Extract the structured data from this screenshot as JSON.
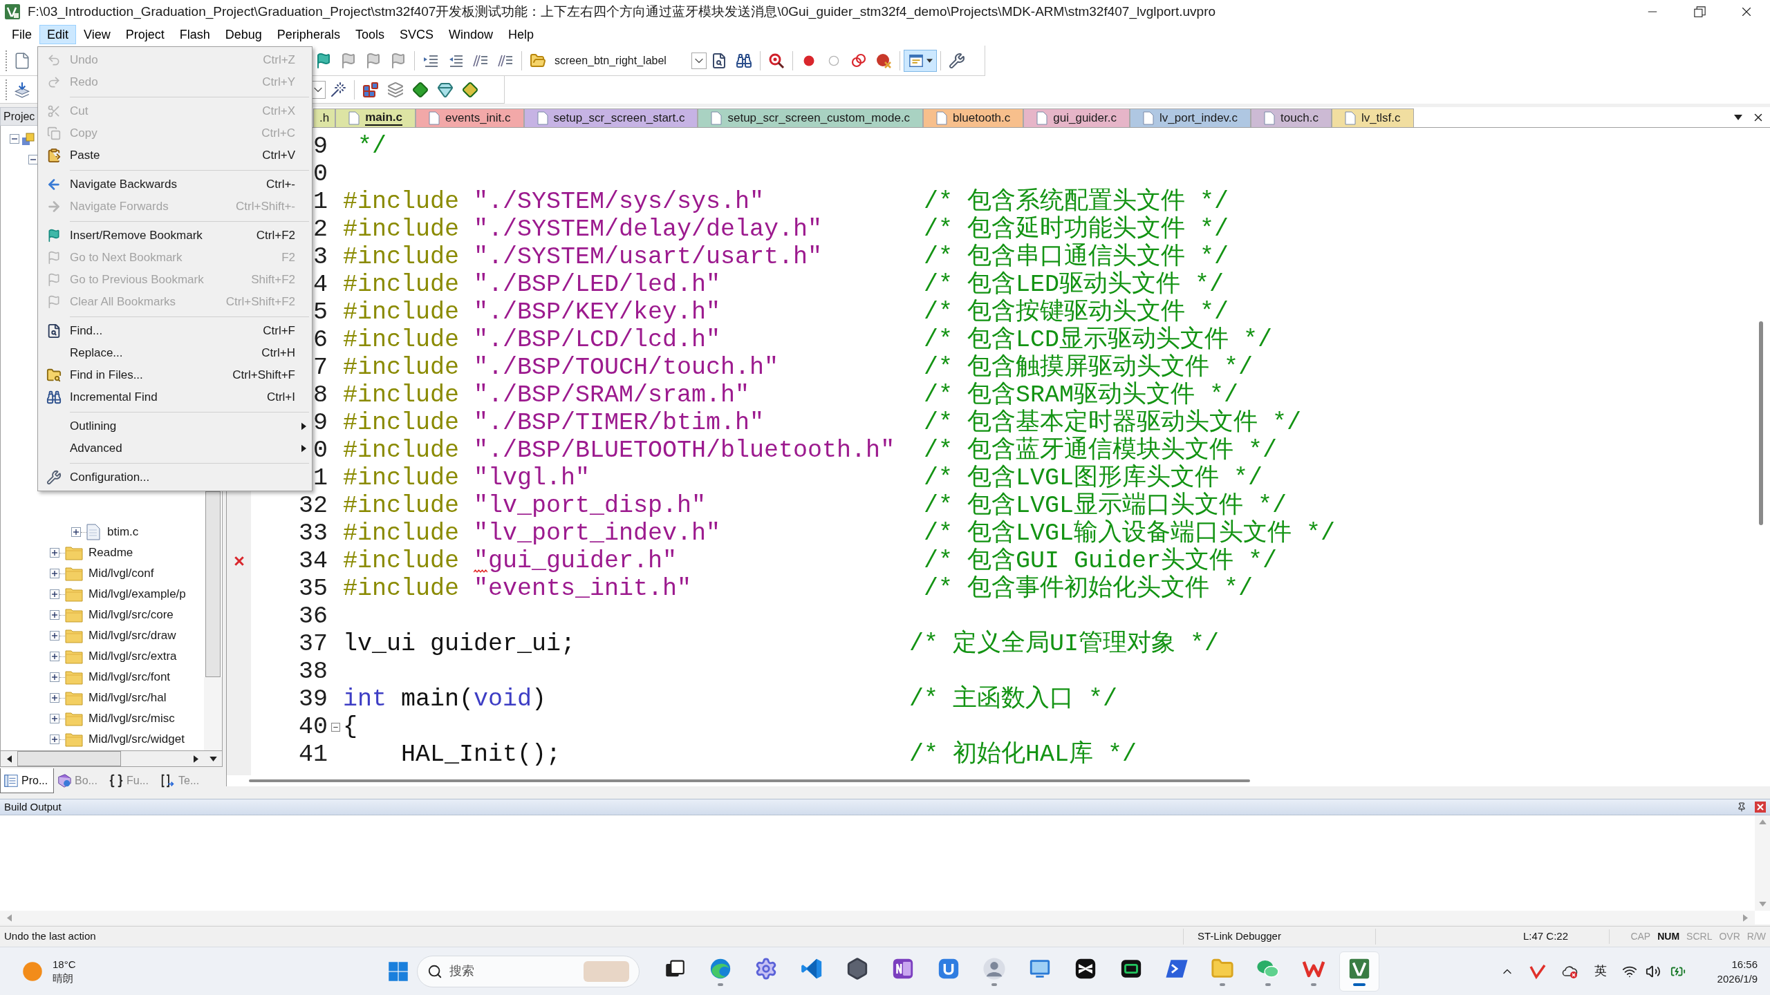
{
  "window": {
    "title": "F:\\03_Introduction_Graduation_Project\\Graduation_Project\\stm32f407开发板测试功能：上下左右四个方向通过蓝牙模块发送消息\\0Gui_guider_stm32f4_demo\\Projects\\MDK-ARM\\stm32f407_lvglport.uvpro"
  },
  "menu_bar": [
    {
      "label": "File",
      "selected": false
    },
    {
      "label": "Edit",
      "selected": true
    },
    {
      "label": "View",
      "selected": false
    },
    {
      "label": "Project",
      "selected": false
    },
    {
      "label": "Flash",
      "selected": false
    },
    {
      "label": "Debug",
      "selected": false
    },
    {
      "label": "Peripherals",
      "selected": false
    },
    {
      "label": "Tools",
      "selected": false
    },
    {
      "label": "SVCS",
      "selected": false
    },
    {
      "label": "Window",
      "selected": false
    },
    {
      "label": "Help",
      "selected": false
    }
  ],
  "toolbar": {
    "target_field": "screen_btn_right_label",
    "layout_button_pressed": true
  },
  "edit_menu": {
    "groups": [
      [
        {
          "label": "Undo",
          "shortcut": "Ctrl+Z",
          "disabled": true,
          "submenu": false
        },
        {
          "label": "Redo",
          "shortcut": "Ctrl+Y",
          "disabled": true,
          "submenu": false
        }
      ],
      [
        {
          "label": "Cut",
          "shortcut": "Ctrl+X",
          "disabled": true,
          "submenu": false
        },
        {
          "label": "Copy",
          "shortcut": "Ctrl+C",
          "disabled": true,
          "submenu": false
        },
        {
          "label": "Paste",
          "shortcut": "Ctrl+V",
          "disabled": false,
          "submenu": false
        }
      ],
      [
        {
          "label": "Navigate Backwards",
          "shortcut": "Ctrl+-",
          "disabled": false,
          "submenu": false
        },
        {
          "label": "Navigate Forwards",
          "shortcut": "Ctrl+Shift+-",
          "disabled": true,
          "submenu": false
        }
      ],
      [
        {
          "label": "Insert/Remove Bookmark",
          "shortcut": "Ctrl+F2",
          "disabled": false,
          "submenu": false
        },
        {
          "label": "Go to Next Bookmark",
          "shortcut": "F2",
          "disabled": true,
          "submenu": false
        },
        {
          "label": "Go to Previous Bookmark",
          "shortcut": "Shift+F2",
          "disabled": true,
          "submenu": false
        },
        {
          "label": "Clear All Bookmarks",
          "shortcut": "Ctrl+Shift+F2",
          "disabled": true,
          "submenu": false
        }
      ],
      [
        {
          "label": "Find...",
          "shortcut": "Ctrl+F",
          "disabled": false,
          "submenu": false
        },
        {
          "label": "Replace...",
          "shortcut": "Ctrl+H",
          "disabled": false,
          "submenu": false
        },
        {
          "label": "Find in Files...",
          "shortcut": "Ctrl+Shift+F",
          "disabled": false,
          "submenu": false
        },
        {
          "label": "Incremental Find",
          "shortcut": "Ctrl+I",
          "disabled": false,
          "submenu": false
        }
      ],
      [
        {
          "label": "Outlining",
          "disabled": false,
          "submenu": true
        },
        {
          "label": "Advanced",
          "disabled": false,
          "submenu": true
        }
      ],
      [
        {
          "label": "Configuration...",
          "disabled": false,
          "submenu": false
        }
      ]
    ]
  },
  "project_panel": {
    "title": "Projec",
    "tree": [
      {
        "kind": "project",
        "expanded": true,
        "children": [
          {
            "kind": "target",
            "expanded": true,
            "children": [
              {
                "kind": "group",
                "expanded": true,
                "children": [
                  {
                    "kind": "file",
                    "label": "btim.c",
                    "expanded": false
                  }
                ]
              },
              {
                "kind": "group",
                "label": "Readme",
                "expanded": false
              },
              {
                "kind": "group",
                "label": "Mid/lvgl/conf",
                "expanded": false
              },
              {
                "kind": "group",
                "label": "Mid/lvgl/example/p",
                "expanded": false
              },
              {
                "kind": "group",
                "label": "Mid/lvgl/src/core",
                "expanded": false
              },
              {
                "kind": "group",
                "label": "Mid/lvgl/src/draw",
                "expanded": false
              },
              {
                "kind": "group",
                "label": "Mid/lvgl/src/extra",
                "expanded": false
              },
              {
                "kind": "group",
                "label": "Mid/lvgl/src/font",
                "expanded": false
              },
              {
                "kind": "group",
                "label": "Mid/lvgl/src/hal",
                "expanded": false
              },
              {
                "kind": "group",
                "label": "Mid/lvgl/src/misc",
                "expanded": false
              },
              {
                "kind": "group",
                "label": "Mid/lvgl/src/widget",
                "expanded": false
              }
            ]
          }
        ]
      }
    ],
    "tabs": [
      {
        "label": "Pro...",
        "selected": true
      },
      {
        "label": "Bo...",
        "selected": false
      },
      {
        "label": "Fu...",
        "selected": false
      },
      {
        "label": "Te...",
        "selected": false
      }
    ]
  },
  "editor": {
    "tabs": [
      {
        "label": ".h",
        "selected": false,
        "color": "#dde4a4"
      },
      {
        "label": "main.c",
        "selected": true,
        "color": "#dde4a4"
      },
      {
        "label": "events_init.c",
        "selected": false,
        "color": "#f2a8a8"
      },
      {
        "label": "setup_scr_screen_start.c",
        "selected": false,
        "color": "#c6b3e4"
      },
      {
        "label": "setup_scr_screen_custom_mode.c",
        "selected": false,
        "color": "#a9d2c2"
      },
      {
        "label": "bluetooth.c",
        "selected": false,
        "color": "#f7bf8c"
      },
      {
        "label": "gui_guider.c",
        "selected": false,
        "color": "#e6b5c8"
      },
      {
        "label": "lv_port_indev.c",
        "selected": false,
        "color": "#afc7e2"
      },
      {
        "label": "touch.c",
        "selected": false,
        "color": "#ccbad4"
      },
      {
        "label": "lv_tlsf.c",
        "selected": false,
        "color": "#f1dea0"
      }
    ],
    "lines": [
      {
        "number": "9",
        "error": false,
        "tokens": [
          {
            "kind": "comment",
            "text": " */"
          }
        ]
      },
      {
        "number": "0",
        "error": false
      },
      {
        "number": "1",
        "error": false,
        "tokens": [
          {
            "kind": "directive",
            "text": "#include "
          },
          {
            "kind": "string",
            "text": "\"./SYSTEM/sys/sys.h\""
          }
        ],
        "comment": "/* 包含系统配置头文件 */"
      },
      {
        "number": "2",
        "error": false,
        "tokens": [
          {
            "kind": "directive",
            "text": "#include "
          },
          {
            "kind": "string",
            "text": "\"./SYSTEM/delay/delay.h\""
          }
        ],
        "comment": "/* 包含延时功能头文件 */"
      },
      {
        "number": "3",
        "error": false,
        "tokens": [
          {
            "kind": "directive",
            "text": "#include "
          },
          {
            "kind": "string",
            "text": "\"./SYSTEM/usart/usart.h\""
          }
        ],
        "comment": "/* 包含串口通信头文件 */"
      },
      {
        "number": "4",
        "error": false,
        "tokens": [
          {
            "kind": "directive",
            "text": "#include "
          },
          {
            "kind": "string",
            "text": "\"./BSP/LED/led.h\""
          }
        ],
        "comment": "/* 包含LED驱动头文件 */"
      },
      {
        "number": "5",
        "error": false,
        "tokens": [
          {
            "kind": "directive",
            "text": "#include "
          },
          {
            "kind": "string",
            "text": "\"./BSP/KEY/key.h\""
          }
        ],
        "comment": "/* 包含按键驱动头文件 */"
      },
      {
        "number": "6",
        "error": false,
        "tokens": [
          {
            "kind": "directive",
            "text": "#include "
          },
          {
            "kind": "string",
            "text": "\"./BSP/LCD/lcd.h\""
          }
        ],
        "comment": "/* 包含LCD显示驱动头文件 */"
      },
      {
        "number": "7",
        "error": false,
        "tokens": [
          {
            "kind": "directive",
            "text": "#include "
          },
          {
            "kind": "string",
            "text": "\"./BSP/TOUCH/touch.h\""
          }
        ],
        "comment": "/* 包含触摸屏驱动头文件 */"
      },
      {
        "number": "8",
        "error": false,
        "tokens": [
          {
            "kind": "directive",
            "text": "#include "
          },
          {
            "kind": "string",
            "text": "\"./BSP/SRAM/sram.h\""
          }
        ],
        "comment": "/* 包含SRAM驱动头文件 */"
      },
      {
        "number": "9",
        "error": false,
        "tokens": [
          {
            "kind": "directive",
            "text": "#include "
          },
          {
            "kind": "string",
            "text": "\"./BSP/TIMER/btim.h\""
          }
        ],
        "comment": "/* 包含基本定时器驱动头文件 */"
      },
      {
        "number": "0",
        "error": false,
        "tokens": [
          {
            "kind": "directive",
            "text": "#include "
          },
          {
            "kind": "string",
            "text": "\"./BSP/BLUETOOTH/bluetooth.h\""
          }
        ],
        "comment": "/* 包含蓝牙通信模块头文件 */"
      },
      {
        "number": "1",
        "error": false,
        "tokens": [
          {
            "kind": "directive",
            "text": "#include "
          },
          {
            "kind": "string",
            "text": "\"lvgl.h\""
          }
        ],
        "comment": "/* 包含LVGL图形库头文件 */"
      },
      {
        "number": "32",
        "error": false,
        "tokens": [
          {
            "kind": "directive",
            "text": "#include "
          },
          {
            "kind": "string",
            "text": "\"lv_port_disp.h\""
          }
        ],
        "comment": "/* 包含LVGL显示端口头文件 */"
      },
      {
        "number": "33",
        "error": false,
        "tokens": [
          {
            "kind": "directive",
            "text": "#include "
          },
          {
            "kind": "string",
            "text": "\"lv_port_indev.h\""
          }
        ],
        "comment": "/* 包含LVGL输入设备端口头文件 */"
      },
      {
        "number": "34",
        "error": true,
        "tokens": [
          {
            "kind": "directive",
            "text": "#include "
          },
          {
            "kind": "string",
            "text": "\"gui_guider.h\""
          }
        ],
        "comment": "/* 包含GUI Guider头文件 */"
      },
      {
        "number": "35",
        "error": false,
        "tokens": [
          {
            "kind": "directive",
            "text": "#include "
          },
          {
            "kind": "string",
            "text": "\"events_init.h\""
          }
        ],
        "comment": "/* 包含事件初始化头文件 */"
      },
      {
        "number": "36",
        "error": false
      },
      {
        "number": "37",
        "error": false,
        "tokens": [
          {
            "kind": "plain",
            "text": "lv_ui guider_ui;"
          }
        ],
        "comment": "/* 定义全局UI管理对象 */"
      },
      {
        "number": "38",
        "error": false
      },
      {
        "number": "39",
        "error": false,
        "tokens": [
          {
            "kind": "keyword",
            "text": "int"
          },
          {
            "kind": "plain",
            "text": " main("
          },
          {
            "kind": "keyword",
            "text": "void"
          },
          {
            "kind": "plain",
            "text": ")"
          }
        ],
        "comment": "/* 主函数入口 */"
      },
      {
        "number": "40",
        "error": false,
        "expanded": true,
        "tokens": [
          {
            "kind": "plain",
            "text": "{"
          }
        ]
      },
      {
        "number": "41",
        "error": false,
        "tokens": [
          {
            "kind": "plain",
            "text": "    HAL_Init();"
          }
        ],
        "comment": "/* 初始化HAL库 */"
      }
    ]
  },
  "build_output": {
    "title": "Build Output"
  },
  "status_bar": {
    "message": "Undo the last action",
    "debugger": "ST-Link Debugger",
    "position": "L:47 C:22",
    "indicators": [
      {
        "label": "CAP",
        "on": false
      },
      {
        "label": "NUM",
        "on": true
      },
      {
        "label": "SCRL",
        "on": false
      },
      {
        "label": "OVR",
        "on": false
      },
      {
        "label": "R/W",
        "on": false
      }
    ]
  },
  "taskbar": {
    "weather": {
      "temperature": "18°C",
      "condition": "晴朗"
    },
    "search": {
      "placeholder": "搜索"
    },
    "apps": [
      {
        "running": false,
        "active": false
      },
      {
        "running": true,
        "active": false
      },
      {
        "running": false,
        "active": false
      },
      {
        "running": false,
        "active": false
      },
      {
        "running": false,
        "active": false
      },
      {
        "running": false,
        "active": false
      },
      {
        "running": false,
        "active": false
      },
      {
        "running": true,
        "active": false
      },
      {
        "running": false,
        "active": false
      },
      {
        "running": false,
        "active": false
      },
      {
        "running": false,
        "active": false
      },
      {
        "running": false,
        "active": false
      },
      {
        "running": true,
        "active": false
      },
      {
        "running": true,
        "active": false
      },
      {
        "running": true,
        "active": false
      },
      {
        "running": true,
        "active": true
      }
    ],
    "tray": {
      "input_method": "英"
    },
    "clock": {
      "time": "16:56",
      "date": "2026/1/9"
    }
  }
}
